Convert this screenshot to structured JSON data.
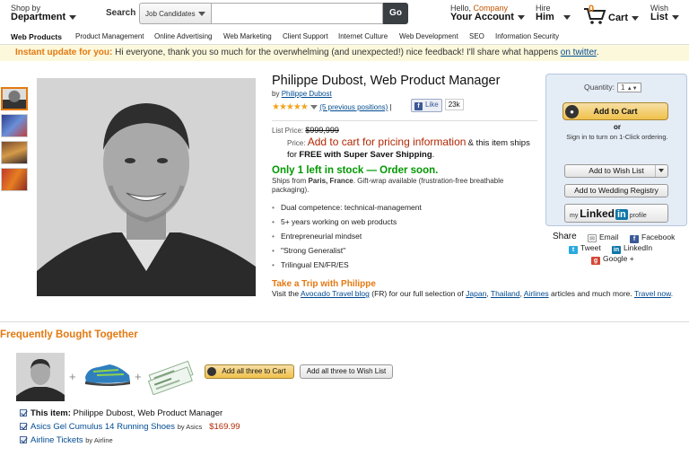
{
  "header": {
    "shop_by_line1": "Shop by",
    "shop_by_line2": "Department",
    "search_label": "Search",
    "search_category": "Job Candidates",
    "search_value": "",
    "go_label": "Go",
    "hello_prefix": "Hello,",
    "hello_company": "Company",
    "your_account": "Your Account",
    "hire_line1": "Hire",
    "hire_line2": "Him",
    "cart_count": "0",
    "cart_label": "Cart",
    "wish_line1": "Wish",
    "wish_line2": "List"
  },
  "nav": {
    "items": [
      "Web Products",
      "Product Management",
      "Online Advertising",
      "Web Marketing",
      "Client Support",
      "Internet Culture",
      "Web Development",
      "SEO",
      "Information Security"
    ]
  },
  "banner": {
    "prefix": "Instant update for you:",
    "text": "Hi everyone, thank you so much for the overwhelming (and unexpected!) nice feedback! I'll share what happens",
    "link": "on twitter",
    "suffix": "."
  },
  "product": {
    "title": "Philippe Dubost, Web Product Manager",
    "by_prefix": "by",
    "author": "Philippe Dubost",
    "stars": "★★★★★",
    "reviews_link": "(5 previous positions)",
    "fb_like": "Like",
    "fb_count": "23k",
    "list_price_label": "List Price:",
    "list_price": "$999,999",
    "price_label": "Price:",
    "price_red": "Add to cart for pricing information",
    "price_and": "& this item ships for",
    "price_free": "FREE with Super Saver Shipping",
    "price_end": ".",
    "stock": "Only 1 left in stock — Order soon.",
    "ships_prefix": "Ships from",
    "ships_from": "Paris, France",
    "ships_suffix": ". Gift-wrap available (frustration-free breathable packaging).",
    "bullets": [
      "Dual competence: technical-management",
      "5+ years working on web products",
      "Entrepreneurial mindset",
      "\"Strong Generalist\"",
      "Trilingual EN/FR/ES"
    ],
    "trip_title": "Take a Trip with Philippe",
    "trip_visit": "Visit the",
    "trip_blog": "Avocado Travel blog",
    "trip_mid": "(FR) for our full selection of",
    "trip_japan": "Japan",
    "trip_comma1": ",",
    "trip_thailand": "Thailand",
    "trip_comma2": ",",
    "trip_airlines": "Airlines",
    "trip_end": "articles and much more.",
    "trip_now": "Travel now",
    "trip_dot": "."
  },
  "buybox": {
    "quantity_label": "Quantity:",
    "quantity_value": "1",
    "add_to_cart": "Add to Cart",
    "or": "or",
    "sign_in": "Sign in to turn on 1-Click ordering.",
    "add_wish": "Add to Wish List",
    "add_wedding": "Add to Wedding Registry",
    "linkedin_my": "my",
    "linkedin_word": "Linked",
    "linkedin_in": "in",
    "linkedin_profile": "profile"
  },
  "share": {
    "label": "Share",
    "email": "Email",
    "facebook": "Facebook",
    "tweet": "Tweet",
    "linkedin": "LinkedIn",
    "google": "Google +"
  },
  "fbt": {
    "title": "Frequently Bought Together",
    "plus": "+",
    "add_all_cart": "Add all three to Cart",
    "add_all_wish": "Add all three to Wish List",
    "item1_label": "This item:",
    "item1_text": "Philippe Dubost, Web Product Manager",
    "item2_link": "Asics Gel Cumulus 14 Running Shoes",
    "item2_by": "by Asics",
    "item2_price": "$169.99",
    "item3_link": "Airline Tickets",
    "item3_by": "by Airline"
  }
}
